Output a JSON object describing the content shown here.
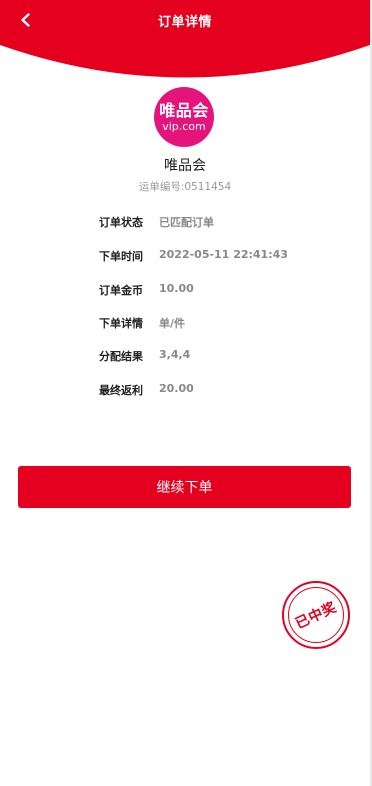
{
  "header": {
    "title": "订单详情",
    "back_icon": "chevron-left-icon",
    "bg_color": "#e5001f"
  },
  "merchant": {
    "logo_text": "唯品会",
    "logo_subtext": "vip.com",
    "logo_color": "#e4147c",
    "name": "唯品会",
    "tracking_number": "运单编号:0511454"
  },
  "details": [
    {
      "label": "订单状态",
      "value": "已匹配订单"
    },
    {
      "label": "下单时间",
      "value": "2022-05-11 22:41:43"
    },
    {
      "label": "订单金币",
      "value": "10.00"
    },
    {
      "label": "下单详情",
      "value": "单/件"
    },
    {
      "label": "分配结果",
      "value": "3,4,4"
    },
    {
      "label": "最终返利",
      "value": "20.00"
    }
  ],
  "actions": {
    "continue_label": "继续下单"
  },
  "stamp": {
    "text": "已中奖",
    "color": "#e5001f"
  }
}
